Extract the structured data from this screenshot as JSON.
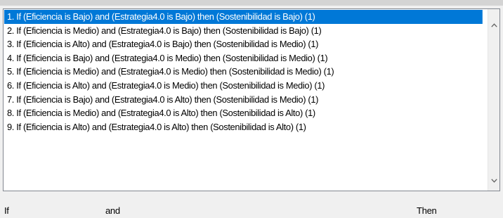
{
  "rules": {
    "selected_index": 0,
    "items": [
      {
        "label": "1. If (Eficiencia is Bajo) and (Estrategia4.0 is Bajo) then (Sostenibilidad is Bajo) (1)"
      },
      {
        "label": "2. If (Eficiencia is Medio) and (Estrategia4.0 is Bajo) then (Sostenibilidad is Bajo) (1)"
      },
      {
        "label": "3. If (Eficiencia is Alto) and (Estrategia4.0 is Bajo) then (Sostenibilidad is Medio) (1)"
      },
      {
        "label": "4. If (Eficiencia is Bajo) and (Estrategia4.0 is Medio) then (Sostenibilidad is Medio) (1)"
      },
      {
        "label": "5. If (Eficiencia is Medio) and (Estrategia4.0 is Medio) then (Sostenibilidad is Medio) (1)"
      },
      {
        "label": "6. If (Eficiencia is Alto) and (Estrategia4.0 is Medio) then (Sostenibilidad is Medio) (1)"
      },
      {
        "label": "7. If (Eficiencia is Bajo) and (Estrategia4.0 is Alto) then (Sostenibilidad is Medio) (1)"
      },
      {
        "label": "8. If (Eficiencia is Medio) and (Estrategia4.0 is Alto) then (Sostenibilidad is Alto) (1)"
      },
      {
        "label": "9. If (Eficiencia is Alto) and (Estrategia4.0 is Alto) then (Sostenibilidad is Alto) (1)"
      }
    ]
  },
  "scrollbar": {
    "up_icon": "chevron-up-icon",
    "down_icon": "chevron-down-icon"
  },
  "footer": {
    "if_label": "If",
    "and_label": "and",
    "then_label": "Then"
  },
  "colors": {
    "selection": "#0078d7",
    "selection_text": "#ffffff",
    "window_bg": "#f0f0f0"
  }
}
